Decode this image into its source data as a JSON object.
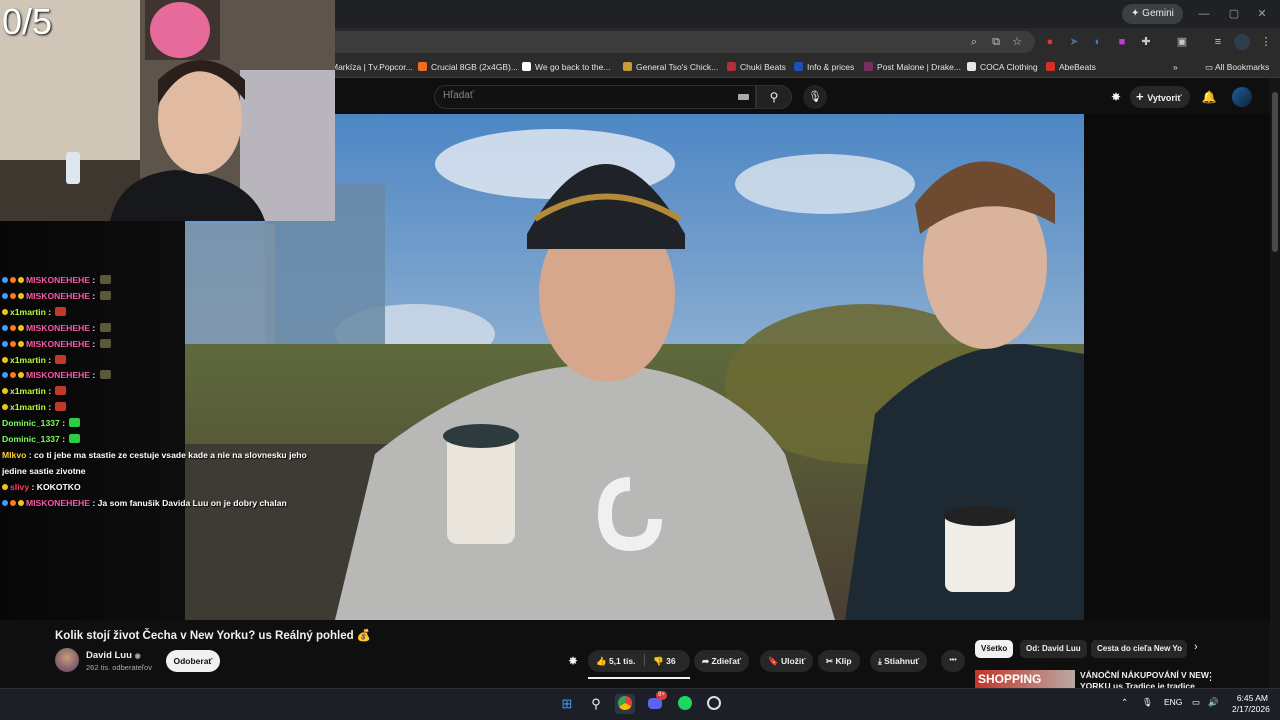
{
  "stream_overlay": {
    "counter": "0/5"
  },
  "browser": {
    "gemini_label": "Gemini",
    "bookmarks": [
      {
        "label": "Markíza | Tv.Popcor...",
        "color": "#d93025"
      },
      {
        "label": "Crucial 8GB (2x4GB)...",
        "color": "#f26b21"
      },
      {
        "label": "We go back to the...",
        "color": "#ffffff"
      },
      {
        "label": "General Tso's Chick...",
        "color": "#c99a3b"
      },
      {
        "label": "Chuki Beats",
        "color": "#b0303a"
      },
      {
        "label": "Info & prices",
        "color": "#1e4fb4"
      },
      {
        "label": "Post Malone | Drake...",
        "color": "#7a2e68"
      },
      {
        "label": "COCA Clothing",
        "color": "#e6e6e6"
      },
      {
        "label": "AbeBeats",
        "color": "#d93025"
      }
    ],
    "all_bookmarks_label": "All Bookmarks"
  },
  "youtube": {
    "search_placeholder": "Hľadať",
    "create_label": "Vytvoriť",
    "video": {
      "title": "Kolik stojí život Čecha v New Yorku? us Reálný pohled 💰",
      "channel_name": "David Luu",
      "subscribers": "262 tis. odberateľov",
      "subscribe_label": "Odoberať",
      "likes": "5,1 tis.",
      "dislikes": "36",
      "share_label": "Zdieľať",
      "save_label": "Uložiť",
      "clip_label": "Klip",
      "download_label": "Stiahnuť",
      "more_label": "•••"
    },
    "chips": [
      "Všetko",
      "Od: David Luu",
      "Cesta do cieľa New Yo"
    ],
    "recommendation": {
      "thumb_text": "SHOPPING",
      "title": "VÁNOČNÍ NÁKUPOVÁNÍ V NEW YORKU us Tradice je tradice"
    }
  },
  "chat": [
    {
      "user": "MISKONEHEHE",
      "color": "#ff5aa8",
      "text": "",
      "badges": [
        "#39a0ff",
        "#ff7a1a",
        "#f0c419"
      ],
      "emote": "#5a5a3a"
    },
    {
      "user": "MISKONEHEHE",
      "color": "#ff5aa8",
      "text": "",
      "badges": [
        "#39a0ff",
        "#ff7a1a",
        "#f0c419"
      ],
      "emote": "#5a5a3a"
    },
    {
      "user": "x1martin",
      "color": "#b8ff3a",
      "text": "",
      "badges": [
        "#f0c419"
      ],
      "emote": "#c0392b"
    },
    {
      "user": "MISKONEHEHE",
      "color": "#ff5aa8",
      "text": "",
      "badges": [
        "#39a0ff",
        "#ff7a1a",
        "#f0c419"
      ],
      "emote": "#5a5a3a"
    },
    {
      "user": "MISKONEHEHE",
      "color": "#ff5aa8",
      "text": "",
      "badges": [
        "#39a0ff",
        "#ff7a1a",
        "#f0c419"
      ],
      "emote": "#5a5a3a"
    },
    {
      "user": "x1martin",
      "color": "#b8ff3a",
      "text": "",
      "badges": [
        "#f0c419"
      ],
      "emote": "#c0392b"
    },
    {
      "user": "MISKONEHEHE",
      "color": "#ff5aa8",
      "text": "",
      "badges": [
        "#39a0ff",
        "#ff7a1a",
        "#f0c419"
      ],
      "emote": "#5a5a3a"
    },
    {
      "user": "x1martin",
      "color": "#b8ff3a",
      "text": "",
      "badges": [
        "#f0c419"
      ],
      "emote": "#c0392b"
    },
    {
      "user": "x1martin",
      "color": "#b8ff3a",
      "text": "",
      "badges": [
        "#f0c419"
      ],
      "emote": "#c0392b"
    },
    {
      "user": "Dominic_1337",
      "color": "#7cff5a",
      "text": "",
      "badges": [],
      "emote": "#2ecc40"
    },
    {
      "user": "Dominic_1337",
      "color": "#7cff5a",
      "text": "",
      "badges": [],
      "emote": "#2ecc40"
    },
    {
      "user": "Mlkvo",
      "color": "#ffd23a",
      "text": "co ti jebe ma stastie ze cestuje vsade kade a nie na slovnesku jeho jedine sastie zivotne",
      "badges": [],
      "emote": ""
    },
    {
      "user": "slivy",
      "color": "#ff3a6a",
      "text": "KOKOTKO",
      "badges": [
        "#f0c419"
      ],
      "emote": ""
    },
    {
      "user": "MISKONEHEHE",
      "color": "#ff5aa8",
      "text": "Ja som fanušik Davida Luu on je dobry chalan",
      "badges": [
        "#39a0ff",
        "#ff7a1a",
        "#f0c419"
      ],
      "emote": ""
    }
  ],
  "taskbar": {
    "language": "ENG",
    "time": "6:45 AM",
    "date": "2/17/2026",
    "discord_badge": "9+"
  }
}
